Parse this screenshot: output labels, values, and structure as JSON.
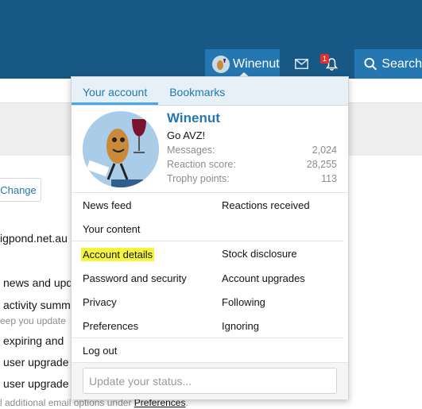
{
  "colors": {
    "header": "#185886",
    "accent": "#2577b1",
    "highlight": "#f5f53c",
    "badge": "#e03030"
  },
  "nav": {
    "username": "Winenut",
    "badge_count": "1",
    "search_label": "Search",
    "icons": [
      "mail-icon",
      "bell-icon",
      "search-icon"
    ]
  },
  "background": {
    "change_label": "Change",
    "email_fragment": "igpond.net.au",
    "opt1": "news and upd",
    "opt2": "activity summ",
    "opt2_small": "eep you update",
    "opt3": "expiring and",
    "opt4": "user upgrade",
    "opt5": "user upgrade",
    "footer_prefix": "l additional email options under ",
    "footer_link": "Preferences",
    "footer_suffix": "."
  },
  "menu": {
    "tabs": [
      "Your account",
      "Bookmarks"
    ],
    "user": {
      "name": "Winenut",
      "title": "Go AVZ!",
      "stats": [
        {
          "label": "Messages:",
          "value": "2,024"
        },
        {
          "label": "Reaction score:",
          "value": "28,255"
        },
        {
          "label": "Trophy points:",
          "value": "113"
        }
      ]
    },
    "links": {
      "news_feed": "News feed",
      "reactions_received": "Reactions received",
      "your_content": "Your content",
      "account_details": "Account details",
      "stock_disclosure": "Stock disclosure",
      "password_security": "Password and security",
      "account_upgrades": "Account upgrades",
      "privacy": "Privacy",
      "following": "Following",
      "preferences": "Preferences",
      "ignoring": "Ignoring",
      "log_out": "Log out"
    },
    "status_placeholder": "Update your status..."
  }
}
